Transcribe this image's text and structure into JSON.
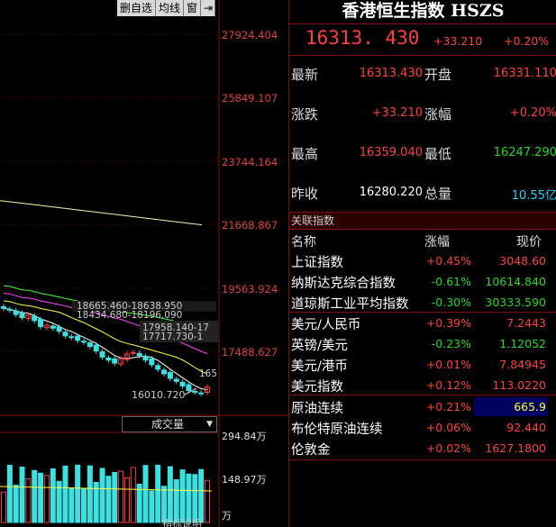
{
  "toolbar": {
    "btn1": "删自选",
    "btn2": "均线",
    "btn3": "窗",
    "arrow": "⇥"
  },
  "price_axis": [
    "27924.404",
    "25849.107",
    "23744.164",
    "21668.867",
    "19563.924",
    "17488.627"
  ],
  "volume_axis": {
    "top": "294.84万",
    "mid": "148.97万",
    "unit": "万"
  },
  "chart_annotations": {
    "a1": "18665.460-18638.950",
    "a2": "18434.680-18196.090",
    "a3": "17958.140-17",
    "a4": "17717.730-1",
    "a5": "165",
    "low": "16010.720"
  },
  "volume_selector": {
    "label": "成交量",
    "indicator": "指标说明"
  },
  "chart_data": {
    "type": "candlestick",
    "low_label": "16010.720",
    "closes": [
      18900,
      18850,
      18700,
      18600,
      18680,
      18500,
      18300,
      18350,
      18250,
      18150,
      18000,
      17950,
      17850,
      17800,
      17650,
      17500,
      17300,
      17200,
      17100,
      17250,
      17400,
      17450,
      17350,
      17200,
      17050,
      16900,
      16750,
      16600,
      16500,
      16350,
      16200,
      16150,
      16100,
      16313
    ]
  },
  "quote": {
    "title": "香港恒生指数 HSZS",
    "price": "16313. 430",
    "change": "+33.210",
    "pct": "+0.20%",
    "rows": [
      {
        "l1": "最新",
        "v1": "16313.430",
        "l2": "开盘",
        "v2": "16331.110"
      },
      {
        "l1": "涨跌",
        "v1": "+33.210",
        "l2": "涨幅",
        "v2": "+0.20%"
      },
      {
        "l1": "最高",
        "v1": "16359.040",
        "l2": "最低",
        "v2": "16247.290"
      },
      {
        "l1": "昨收",
        "v1": "16280.220",
        "l2": "总量",
        "v2": "10.55亿"
      }
    ]
  },
  "related": {
    "section": "关联指数",
    "headers": {
      "name": "名称",
      "chg": "涨幅",
      "price": "现价"
    },
    "items": [
      {
        "name": "上证指数",
        "chg": "+0.45%",
        "price": "3048.60"
      },
      {
        "name": "纳斯达克综合指数",
        "chg": "-0.61%",
        "price": "10614.840"
      },
      {
        "name": "道琼斯工业平均指数",
        "chg": "-0.30%",
        "price": "30333.590"
      },
      {
        "name": "美元/人民币",
        "chg": "+0.39%",
        "price": "7.2443"
      },
      {
        "name": "英镑/美元",
        "chg": "-0.23%",
        "price": "1.12052"
      },
      {
        "name": "美元/港币",
        "chg": "+0.01%",
        "price": "7.84945"
      },
      {
        "name": "美元指数",
        "chg": "+0.12%",
        "price": "113.0220"
      },
      {
        "name": "原油连续",
        "chg": "+0.21%",
        "price": "665.9"
      },
      {
        "name": "布伦特原油连续",
        "chg": "+0.06%",
        "price": "92.440"
      },
      {
        "name": "伦敦金",
        "chg": "+0.02%",
        "price": "1627.1800"
      }
    ]
  }
}
